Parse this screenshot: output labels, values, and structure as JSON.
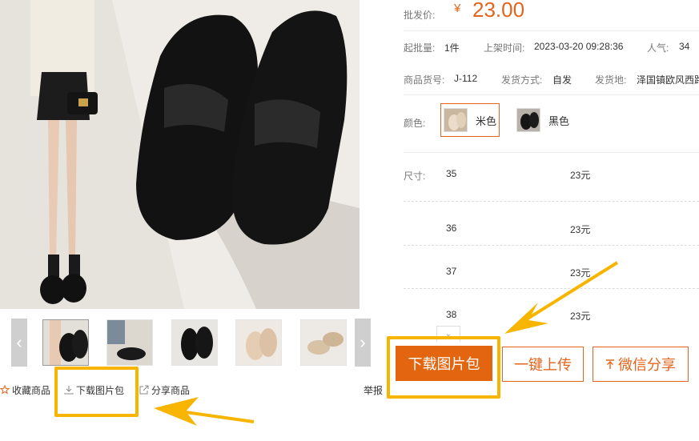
{
  "product": {
    "price_label": "批发价:",
    "currency": "¥",
    "price": "23.00",
    "min_order_label": "起批量:",
    "min_order_value": "1件",
    "listed_label": "上架时间:",
    "listed_value": "2023-03-20 09:28:36",
    "popularity_label": "人气:",
    "popularity_value": "34",
    "sku_label": "商品货号:",
    "sku_value": "J-112",
    "ship_method_label": "发货方式:",
    "ship_method_value": "自发",
    "ship_from_label": "发货地:",
    "ship_from_value": "泽国镇欧风西路"
  },
  "color": {
    "label": "颜色:",
    "options": [
      {
        "name": "米色",
        "selected": true
      },
      {
        "name": "黑色",
        "selected": false
      }
    ]
  },
  "size": {
    "label": "尺寸:",
    "rows": [
      {
        "size": "35",
        "price": "23元"
      },
      {
        "size": "36",
        "price": "23元"
      },
      {
        "size": "37",
        "price": "23元"
      },
      {
        "size": "38",
        "price": "23元"
      }
    ]
  },
  "actions": {
    "favorite": "收藏商品",
    "download_pack": "下载图片包",
    "share": "分享商品",
    "report": "举报"
  },
  "buttons": {
    "download_pack": "下载图片包",
    "one_click_upload": "一键上传",
    "wechat_share": "微信分享"
  },
  "colors": {
    "accent": "#e4650f",
    "highlight": "#f7b500"
  }
}
